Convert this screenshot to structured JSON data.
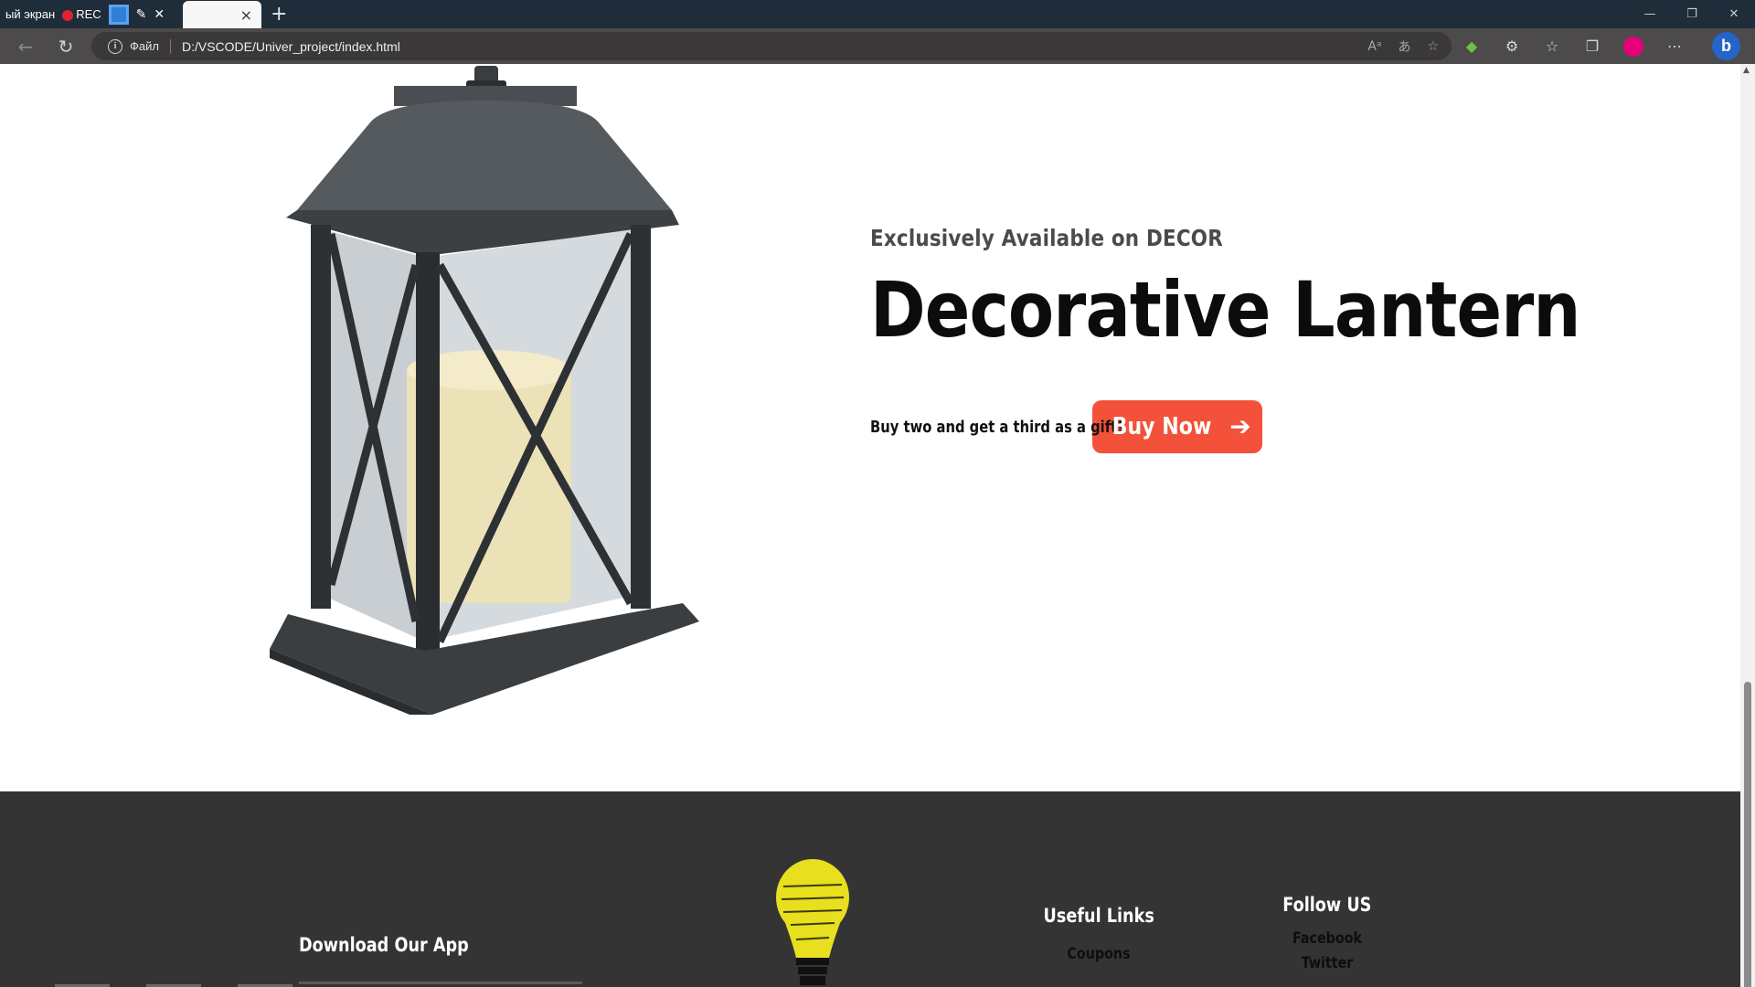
{
  "browser": {
    "recording_label": "ый экран",
    "rec_label": "REC",
    "tab_close_glyph": "×",
    "new_tab_glyph": "+",
    "file_label": "Файл",
    "url": "D:/VSCODE/Univer_project/index.html",
    "window_controls": {
      "minimize": "—",
      "restore": "❐",
      "close": "✕"
    }
  },
  "hero": {
    "eyebrow": "Exclusively Available on DECOR",
    "title": "Decorative Lantern",
    "offer": "Buy two and get a third as a gift!",
    "cta_label": "Buy Now",
    "cta_arrow": "➔"
  },
  "footer": {
    "app_heading": "Download Our App",
    "useful_links": {
      "heading": "Useful Links",
      "items": [
        "Coupons"
      ]
    },
    "follow": {
      "heading": "Follow US",
      "items": [
        "Facebook",
        "Twitter"
      ]
    }
  },
  "colors": {
    "accent": "#f3513a",
    "footer_bg": "#343434",
    "tabbar_bg": "#1f2c3a",
    "toolbar_bg": "#4c4a4a",
    "profile": "#e6007a",
    "bulb_yellow": "#e8df1e"
  },
  "icons": [
    "info-icon",
    "back-icon",
    "reload-icon",
    "read-aloud-icon",
    "translate-icon",
    "favorite-add-icon",
    "extension-icon",
    "puzzle-icon",
    "favorites-icon",
    "collections-icon",
    "more-icon",
    "bing-icon",
    "pencil-icon",
    "lightbulb-icon"
  ]
}
